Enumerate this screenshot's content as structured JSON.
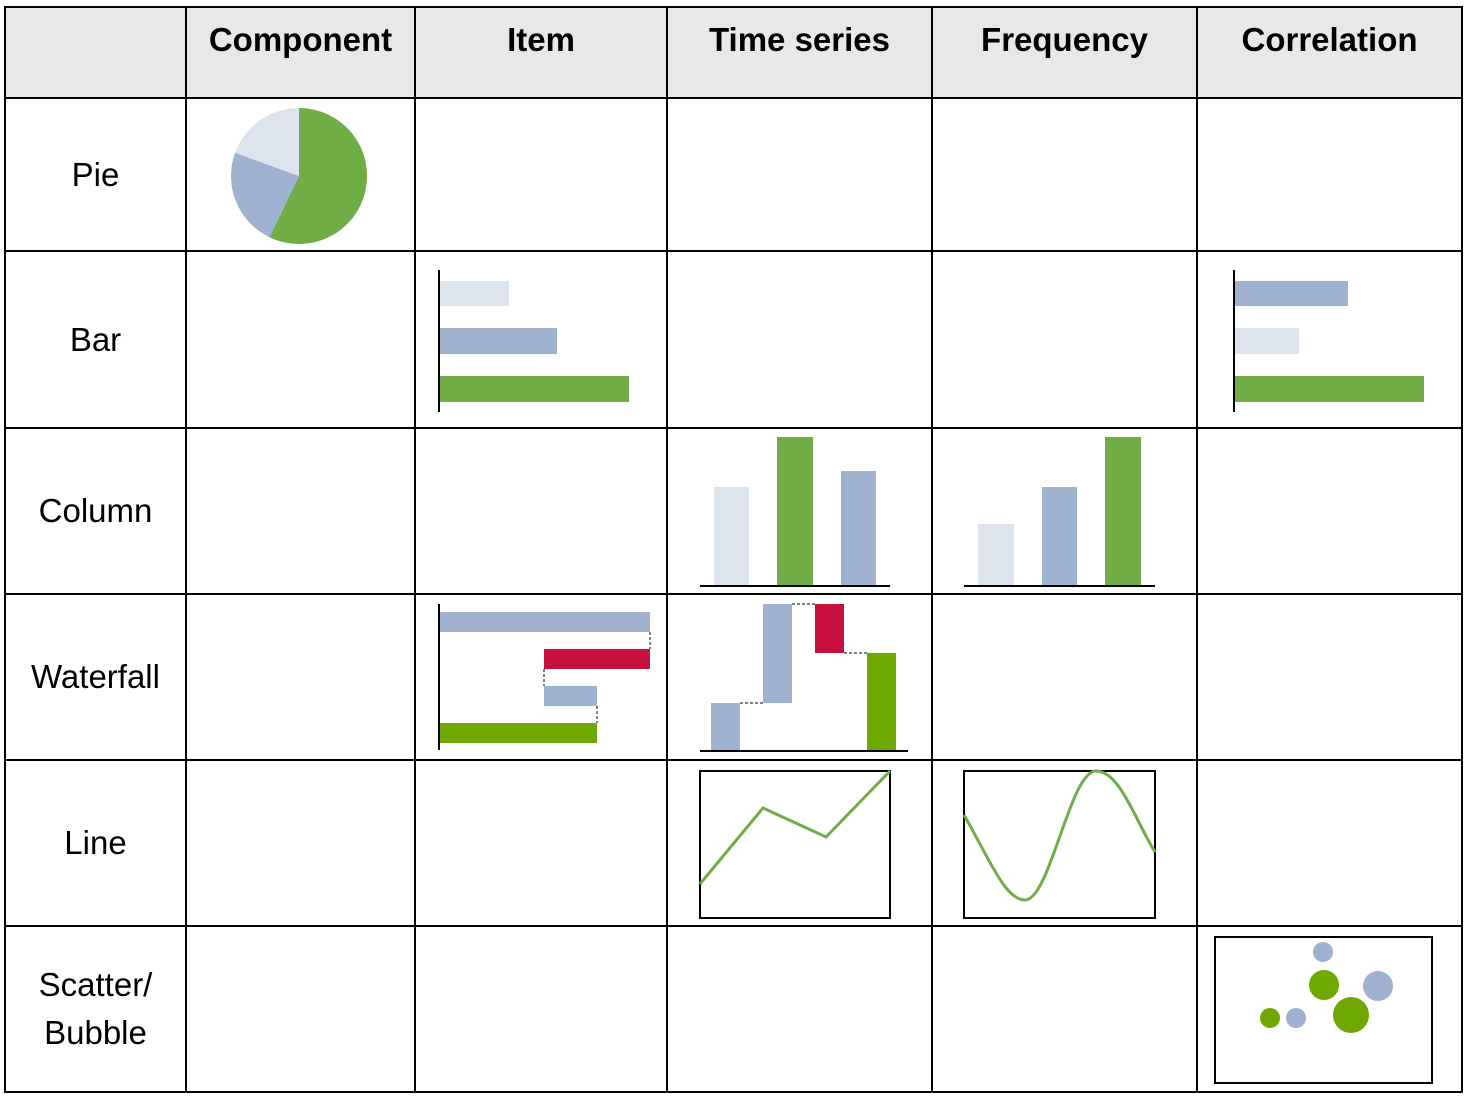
{
  "columns": [
    "",
    "Component",
    "Item",
    "Time series",
    "Frequency",
    "Correlation"
  ],
  "rows": [
    "Pie",
    "Bar",
    "Column",
    "Waterfall",
    "Line",
    "Scatter/\nBubble"
  ],
  "row_labels_display": {
    "scatter_line1": "Scatter/",
    "scatter_line2": "Bubble"
  },
  "colors": {
    "header_bg": "#e8e8e8",
    "grid": "#000000",
    "green": "#70ad47",
    "dark_green": "#6ea800",
    "blue_gray": "#9fb2cf",
    "light_gray_blue": "#dee4ee",
    "red": "#c8103e"
  }
}
